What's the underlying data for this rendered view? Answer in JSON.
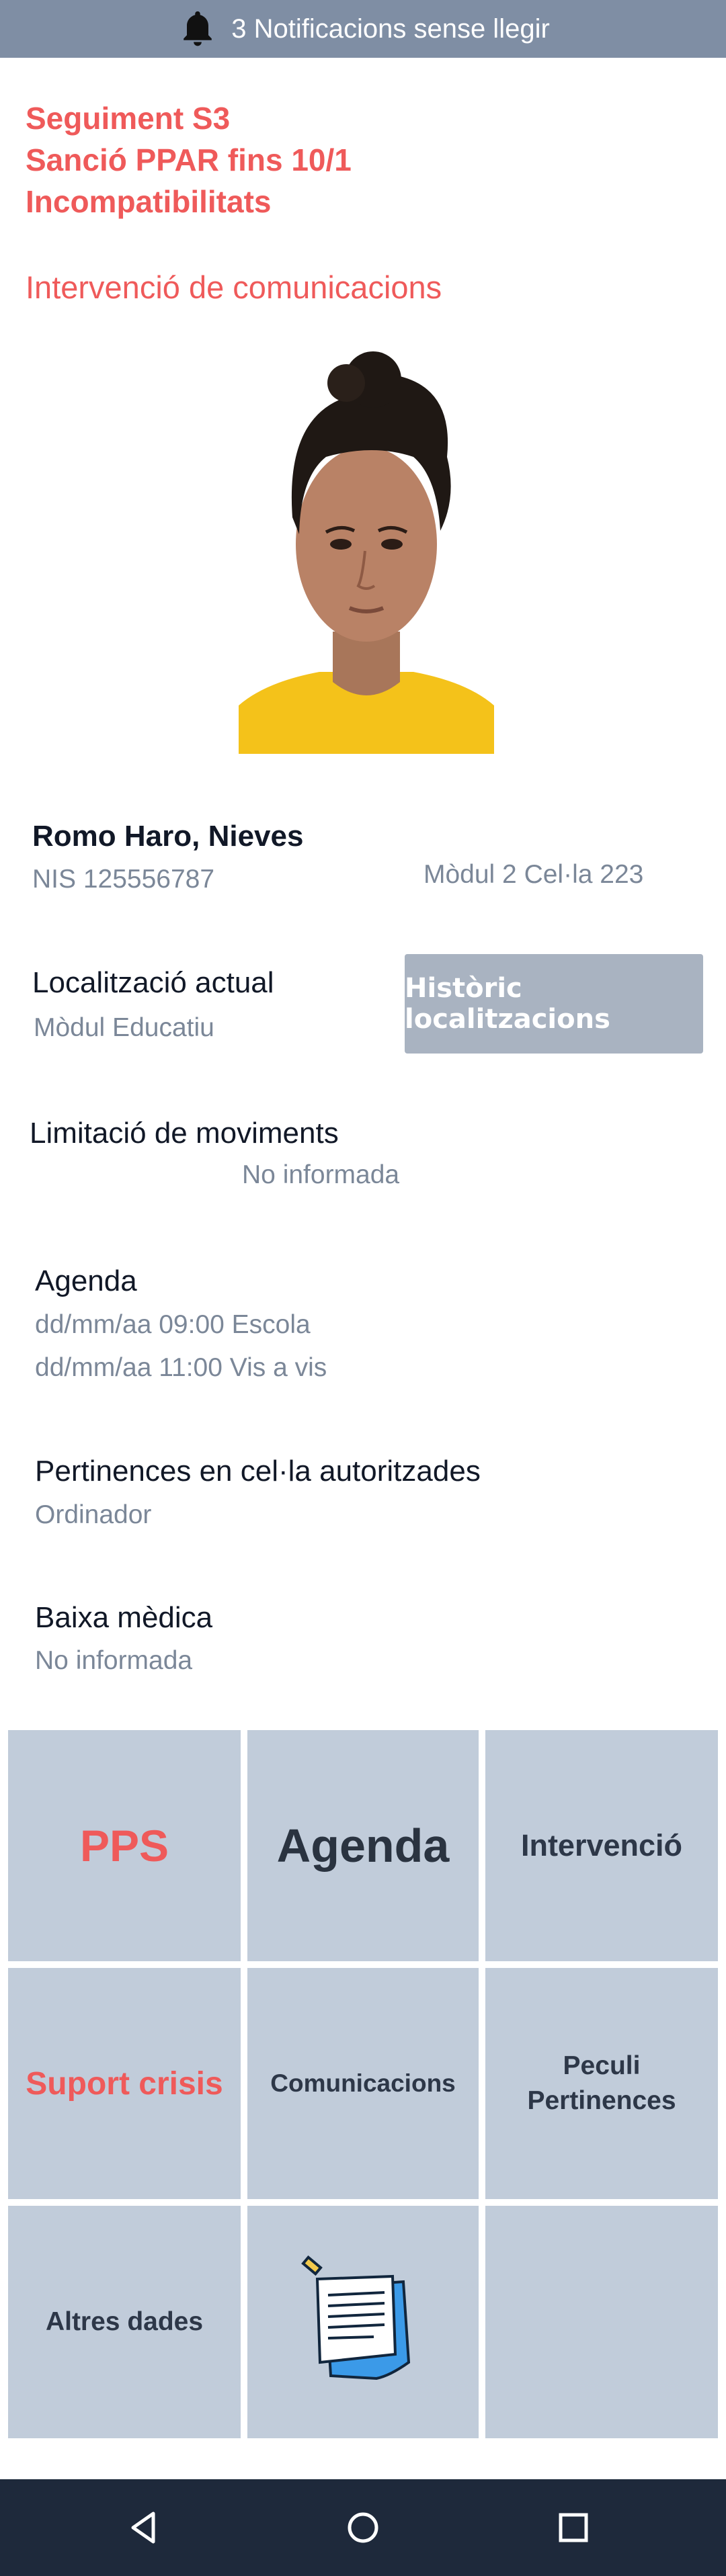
{
  "notification": {
    "text": "3 Notificacions sense llegir",
    "icon": "bell-icon"
  },
  "alerts": [
    "Seguiment S3",
    "Sanció PPAR fins 10/1",
    "Incompatibilitats"
  ],
  "subalert": "Intervenció de comunicacions",
  "person": {
    "name": "Romo Haro, Nieves",
    "nis": "NIS 125556787",
    "cell": "Mòdul 2 Cel·la 223"
  },
  "location": {
    "label": "Localització actual",
    "value": "Mòdul Educatiu",
    "history_button": "Històric localitzacions"
  },
  "movement": {
    "label": "Limitació de moviments",
    "value": "No informada"
  },
  "agenda": {
    "label": "Agenda",
    "items": [
      "dd/mm/aa 09:00 Escola",
      "dd/mm/aa 11:00 Vis a vis"
    ]
  },
  "belongings": {
    "label": "Pertinences en cel·la autoritzades",
    "value": "Ordinador"
  },
  "medical": {
    "label": "Baixa mèdica",
    "value": "No informada"
  },
  "tiles": [
    {
      "label": "PPS"
    },
    {
      "label": "Agenda"
    },
    {
      "label": "Intervenció"
    },
    {
      "label": "Suport crisis"
    },
    {
      "label": "Comunicacions"
    },
    {
      "label": "Peculi",
      "label2": "Pertinences"
    },
    {
      "label": "Altres dades"
    },
    {
      "icon": "notepad-icon"
    },
    {
      "label": ""
    }
  ],
  "colors": {
    "accent": "#ef5a5a",
    "tile": "#c1ccda",
    "status_bar": "#7f8ea4",
    "nav_bar": "#1e293b"
  },
  "nav": [
    "back-icon",
    "home-icon",
    "recents-icon"
  ]
}
